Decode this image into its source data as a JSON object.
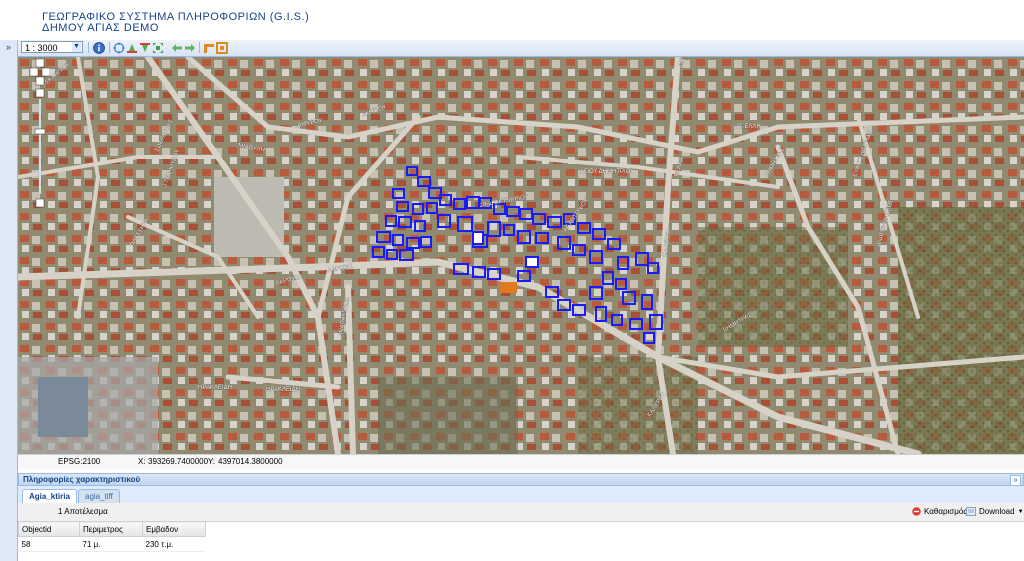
{
  "header": {
    "title_line1": "ΓΕΩΓΡΑΦΙΚΟ ΣΥΣΤΗΜΑ ΠΛΗΡΟΦΟΡΙΩΝ (G.I.S.)",
    "title_line2": "ΔΗΜΟΥ ΑΓΙΑΣ DEMO"
  },
  "west_panel": {
    "expand_glyph": "»"
  },
  "toolbar": {
    "scale_value": "1 : 3000",
    "tools": [
      "info-icon",
      "pan-icon",
      "zoom-in-icon",
      "zoom-out-icon",
      "zoom-extent-icon",
      "previous-extent-icon",
      "next-extent-icon",
      "measure-distance-icon",
      "measure-area-icon"
    ],
    "accent": "#15428b"
  },
  "map": {
    "street_labels": [
      "ΑΣΚΛΗΠΙΟΥ",
      "ΣΩΚΡΑΤΟΥΣ",
      "ΑΜΥΡΟΥ",
      "ΑΜΥΡΟΥ",
      "ΜΙΑΟΥΛΗ",
      "ΑΓΙΟΥ ΔΗΜΗΤΡΙΟΥ",
      "ΑΓ.ΕΛΛΗ",
      "ΣΤΕΦ.ΚΙΤΣΟΥ",
      "28ης ΟΚΤΩΒΡΙΟΥ",
      "ΛΑΡΙΣΗΣ",
      "ΛΑΡΙΣΗΣ",
      "ΑΝΑΠΑΥΣΕΩΣ",
      "ΗΡΑΚΛΕΙΔΗ",
      "ΗΡΑΚΛΕΙΔΗ",
      "ΔΗΜΗΤΡΑΣ",
      "ΔΗΜΗΤΡΑΣ",
      "ΚΑΛΕΡΓΗ",
      "ΚΑΛΕΡΓΗ",
      "ΒΕΛΛΑ",
      "ΕΥΑΓΓΕΛΙΣΤΡΙΑΣ",
      "ΑΝΑΓΕΝΝΗΣΕΩΣ",
      "ΑΓ.ΑΝΤΩΝΙΟΥ",
      "ΠΛΑΣΤΗΡΑ",
      "ΔΗΜΗΤΡΑΣ"
    ],
    "selection_color": "#1a1aff",
    "highlight_color": "#e07a1e"
  },
  "status": {
    "crs": "EPSG:2100",
    "x_label": "X:",
    "x_value": "393269.7400000",
    "y_label": "Y:",
    "y_value": "4397014.3800000"
  },
  "info_panel": {
    "title": "Πληροφορίες χαρακτηριστικού",
    "collapse_glyph": "»",
    "tabs": [
      {
        "label": "Agia_ktiria",
        "active": true
      },
      {
        "label": "agia_tiff",
        "active": false
      }
    ],
    "result_count": "1 Αποτέλεσμα",
    "clear_label": "Καθαρισμός",
    "download_label": "Download",
    "columns": [
      "Objectid",
      "Περιμετρος",
      "Εμβαδον"
    ],
    "rows": [
      [
        "58",
        "71 μ.",
        "230 τ.μ."
      ]
    ]
  }
}
